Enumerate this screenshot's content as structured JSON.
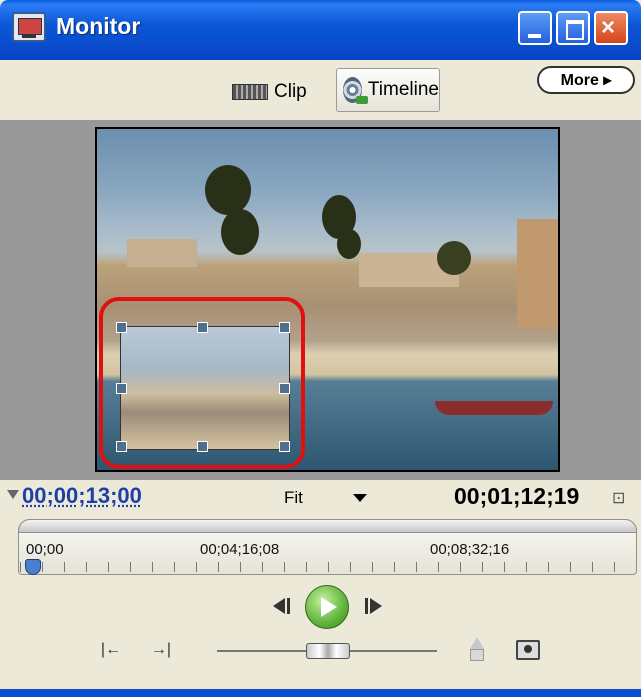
{
  "window": {
    "title": "Monitor",
    "buttons": {
      "minimize": "minimize",
      "maximize": "maximize",
      "close": "×"
    }
  },
  "toolbar": {
    "clip_tab": "Clip",
    "timeline_tab": "Timeline",
    "more_button": "More ▸"
  },
  "timecode": {
    "current": "00;00;13;00",
    "zoom": "Fit",
    "duration": "00;01;12;19",
    "duration_icon": "⊡"
  },
  "ruler": {
    "labels": [
      "00;00",
      "00;04;16;08",
      "00;08;32;16"
    ]
  },
  "transport": {
    "set_in": "|←",
    "set_out": "→|"
  },
  "colors": {
    "titlebar": "#0a4ed0",
    "timecode_blue": "#1f3fa8",
    "highlight_red": "#e01010",
    "play_green": "#5fb43a"
  }
}
